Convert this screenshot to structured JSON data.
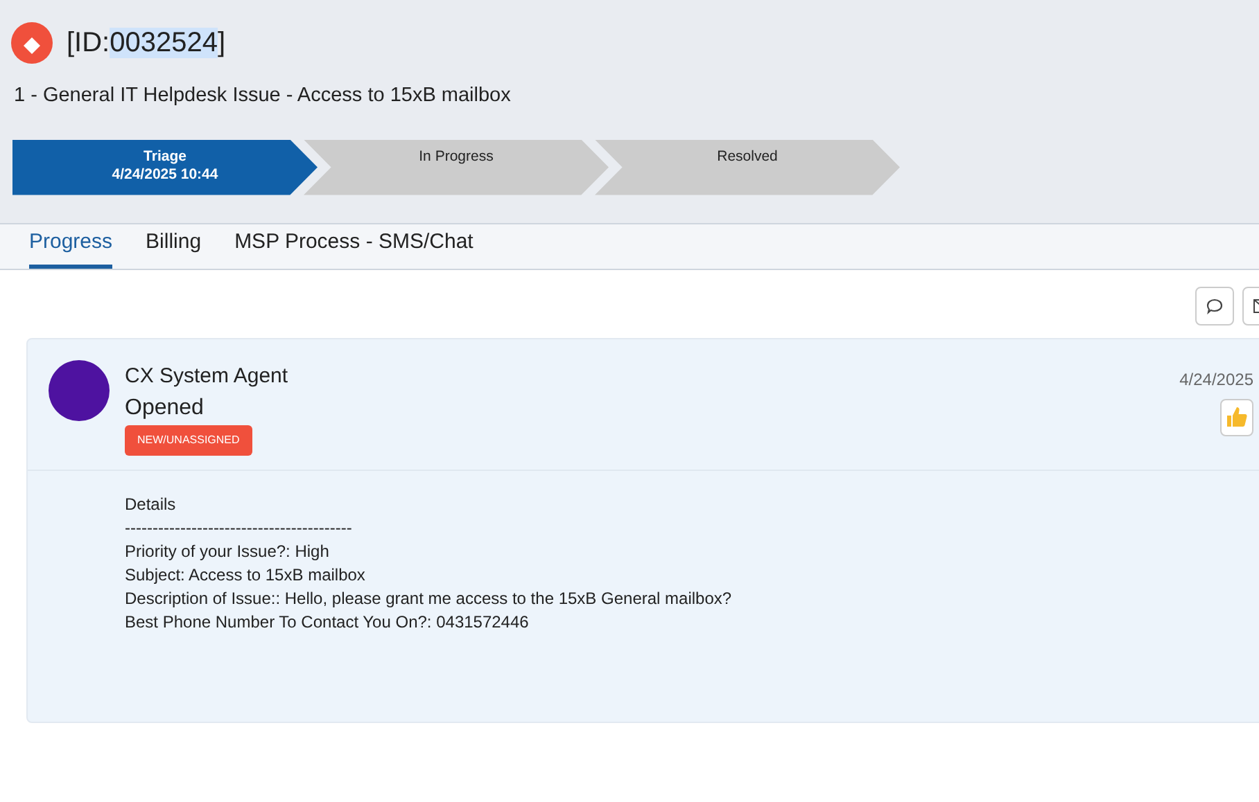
{
  "ticket": {
    "id_prefix": "[ID:",
    "id_value": "0032524",
    "id_suffix": "]",
    "id_value_highlighted": true,
    "subtitle": "1 - General IT Helpdesk Issue - Access to 15xB mailbox"
  },
  "stages": [
    {
      "label": "Triage",
      "date": "4/24/2025 10:44",
      "selected": true
    },
    {
      "label": "In Progress",
      "selected": false
    },
    {
      "label": "Resolved",
      "selected": false
    }
  ],
  "tabs": [
    {
      "label": "Progress",
      "selected": true
    },
    {
      "label": "Billing",
      "selected": false
    },
    {
      "label": "MSP Process - SMS/Chat",
      "selected": false
    }
  ],
  "activity": {
    "author": "CX System Agent",
    "action": "Opened",
    "badge": "NEW/UNASSIGNED",
    "date": "4/24/2025",
    "details": [
      "Details",
      "-----------------------------------------",
      "Priority of your Issue?: High",
      "Subject: Access to 15xB mailbox",
      "Description of Issue:: Hello, please grant me access to the 15xB General mailbox?",
      "Best Phone Number To Contact You On?: 0431572446"
    ]
  }
}
